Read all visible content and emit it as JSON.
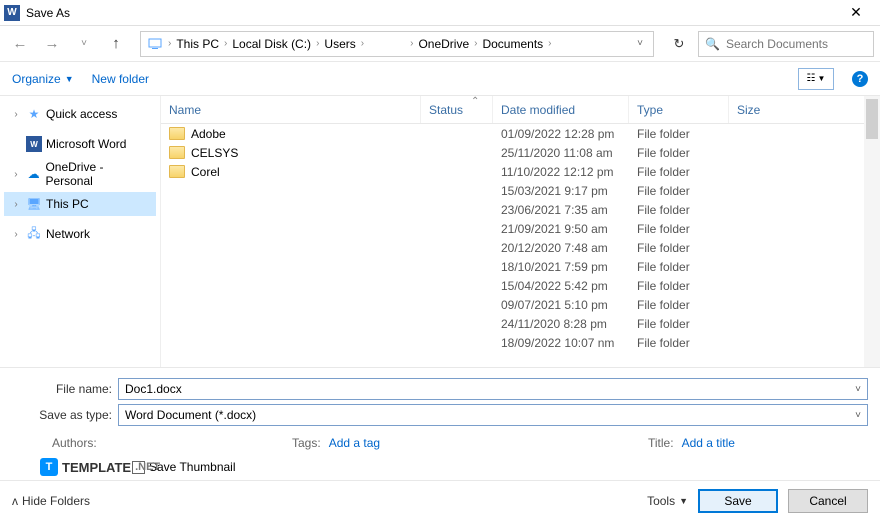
{
  "title": "Save As",
  "breadcrumb": {
    "items": [
      "This PC",
      "Local Disk (C:)",
      "Users",
      "",
      "OneDrive",
      "Documents"
    ]
  },
  "search": {
    "placeholder": "Search Documents"
  },
  "toolbar": {
    "organize": "Organize",
    "newfolder": "New folder"
  },
  "tree": {
    "items": [
      {
        "label": "Quick access",
        "icon": "star",
        "chev": "›"
      },
      {
        "label": "Microsoft Word",
        "icon": "word",
        "chev": ""
      },
      {
        "label": "OneDrive - Personal",
        "icon": "cloud",
        "chev": "›"
      },
      {
        "label": "This PC",
        "icon": "pc",
        "chev": "›",
        "selected": true
      },
      {
        "label": "Network",
        "icon": "net",
        "chev": "›"
      }
    ]
  },
  "columns": {
    "name": "Name",
    "status": "Status",
    "date": "Date modified",
    "type": "Type",
    "size": "Size"
  },
  "rows": [
    {
      "name": "Adobe",
      "date": "01/09/2022 12:28 pm",
      "type": "File folder"
    },
    {
      "name": "CELSYS",
      "date": "25/11/2020 11:08 am",
      "type": "File folder"
    },
    {
      "name": "Corel",
      "date": "11/10/2022 12:12 pm",
      "type": "File folder"
    },
    {
      "name": "",
      "date": "15/03/2021 9:17 pm",
      "type": "File folder"
    },
    {
      "name": "",
      "date": "23/06/2021 7:35 am",
      "type": "File folder"
    },
    {
      "name": "",
      "date": "21/09/2021 9:50 am",
      "type": "File folder"
    },
    {
      "name": "",
      "date": "20/12/2020 7:48 am",
      "type": "File folder"
    },
    {
      "name": "",
      "date": "18/10/2021 7:59 pm",
      "type": "File folder"
    },
    {
      "name": "",
      "date": "15/04/2022 5:42 pm",
      "type": "File folder"
    },
    {
      "name": "",
      "date": "09/07/2021 5:10 pm",
      "type": "File folder"
    },
    {
      "name": "",
      "date": "24/11/2020 8:28 pm",
      "type": "File folder"
    },
    {
      "name": "",
      "date": "18/09/2022 10:07 nm",
      "type": "File folder"
    }
  ],
  "form": {
    "filename_label": "File name:",
    "filename": "Doc1.docx",
    "type_label": "Save as type:",
    "type": "Word Document (*.docx)",
    "authors_label": "Authors:",
    "tags_label": "Tags:",
    "tags_hint": "Add a tag",
    "title_label": "Title:",
    "title_hint": "Add a title",
    "thumb_label": "Save Thumbnail"
  },
  "footer": {
    "hide": "Hide Folders",
    "tools": "Tools",
    "save": "Save",
    "cancel": "Cancel"
  },
  "watermark": {
    "brand": "TEMPLATE",
    "suffix": ".NET"
  }
}
